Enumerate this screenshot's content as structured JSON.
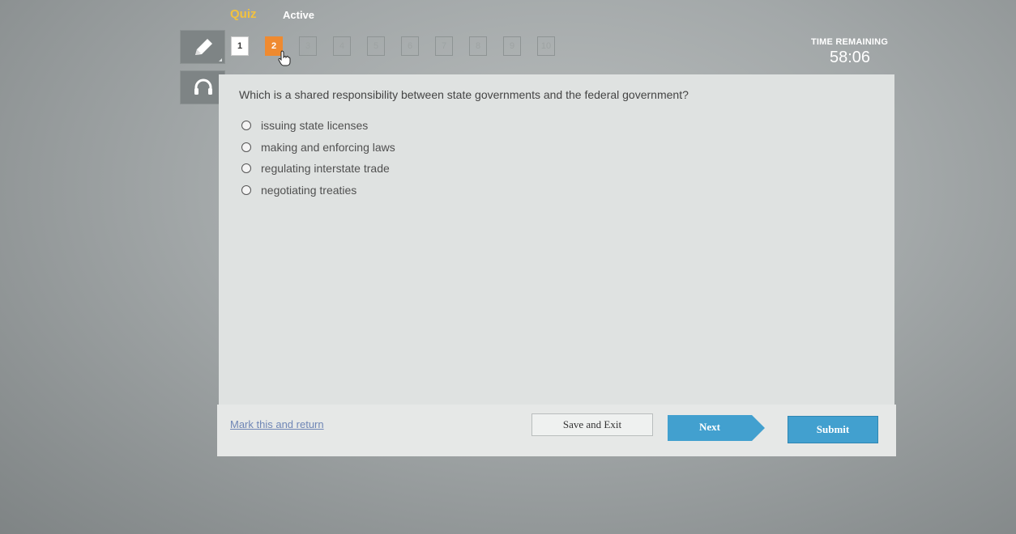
{
  "header": {
    "title": "Quiz",
    "status": "Active"
  },
  "tools": [
    {
      "name": "pencil-icon"
    },
    {
      "name": "headphones-icon"
    }
  ],
  "question_nav": {
    "items": [
      "1",
      "2",
      "3",
      "4",
      "5",
      "6",
      "7",
      "8",
      "9",
      "10"
    ],
    "current": "2",
    "visited": [
      "1"
    ]
  },
  "timer": {
    "label": "TIME REMAINING",
    "value": "58:06"
  },
  "question": {
    "text": "Which is a shared responsibility between state governments and the federal government?",
    "options": [
      "issuing state licenses",
      "making and enforcing laws",
      "regulating interstate trade",
      "negotiating treaties"
    ]
  },
  "footer": {
    "mark_label": "Mark this and return",
    "save_label": "Save and Exit",
    "next_label": "Next",
    "submit_label": "Submit"
  },
  "colors": {
    "accent_orange": "#ef8a30",
    "title_yellow": "#f3c23d",
    "button_blue": "#42a0cf"
  }
}
